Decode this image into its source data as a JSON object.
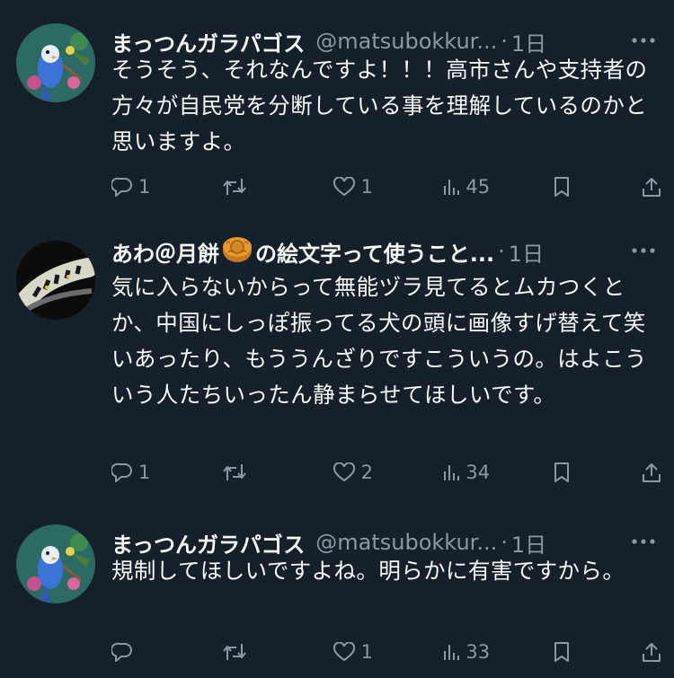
{
  "tweets": [
    {
      "name": "まっつんガラパゴス",
      "handle": "@matsubokkur...",
      "time": "1日",
      "text": "そうそう、それなんですよ！！！高市さんや支持者の方々が自民党を分断している事を理解しているのかと思いますよ。",
      "replies": "1",
      "retweets": "",
      "likes": "1",
      "views": "45",
      "avatar_icon": "parakeet-avatar-icon"
    },
    {
      "name_part1": "あわ＠月餅",
      "name_emoji": "mooncake-emoji-icon",
      "name_part2": "の絵文字って使うこと...",
      "time": "1日",
      "text": "気に入らないからって無能ヅラ見てるとムカつくとか、中国にしっぽ振ってる犬の頭に画像すげ替えて笑いあったり、もううんざりですこういうの。はよこういう人たちいったん静まらせてほしいです。",
      "replies": "1",
      "retweets": "",
      "likes": "2",
      "views": "34",
      "avatar_icon": "caterpillar-avatar-icon"
    },
    {
      "name": "まっつんガラパゴス",
      "handle": "@matsubokkur...",
      "time": "1日",
      "text": "規制してほしいですよね。明らかに有害ですから。",
      "replies": "",
      "retweets": "",
      "likes": "1",
      "views": "33",
      "avatar_icon": "parakeet-avatar-icon"
    }
  ],
  "separator": "·",
  "colors": {
    "background": "#15202b",
    "text": "#f7f9f9",
    "secondary": "#8b98a5"
  }
}
